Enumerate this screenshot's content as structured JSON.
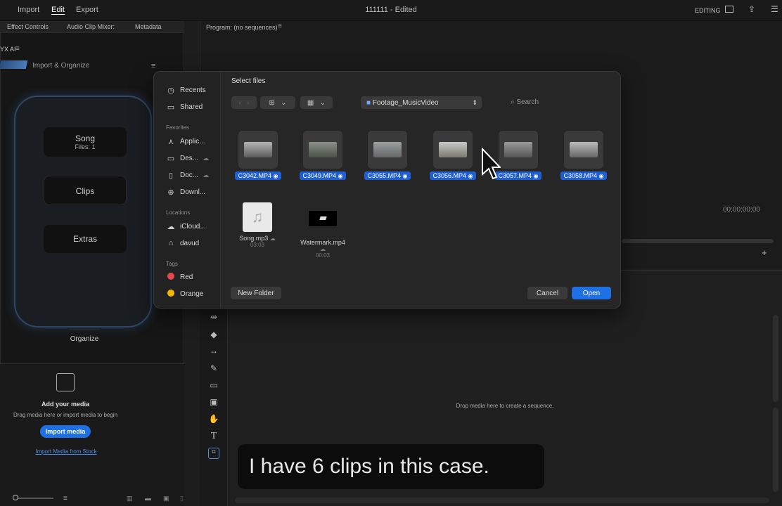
{
  "app": {
    "menu": [
      "Import",
      "Edit",
      "Export"
    ],
    "title": "111111 - Edited",
    "mode": "EDITING"
  },
  "panels": {
    "tabs": [
      "Effect Controls",
      "Audio Clip Mixer:",
      "Metadata"
    ],
    "program": "Program: (no sequences)",
    "plugin_tab": "YX AI",
    "plugin_header": "Import & Organize",
    "timecode": "00;00;00;00",
    "drop_hint": "Drop media here to create a sequence."
  },
  "phone": {
    "song_label": "Song",
    "song_files": "Files: 1",
    "clips_label": "Clips",
    "extras_label": "Extras",
    "organize_label": "Organize"
  },
  "import": {
    "title": "Add your media",
    "hint": "Drag media here or import media to begin",
    "button": "Import media",
    "stock_link": "Import Media from Stock"
  },
  "dialog": {
    "title": "Select files",
    "folder": "Footage_MusicVideo",
    "search_placeholder": "Search",
    "new_folder": "New Folder",
    "cancel": "Cancel",
    "open": "Open",
    "sidebar": {
      "recents": "Recents",
      "shared": "Shared",
      "favorites_header": "Favorites",
      "favorites": [
        "Applic...",
        "Des...",
        "Doc...",
        "Downl..."
      ],
      "locations_header": "Locations",
      "locations": [
        "iCloud...",
        "davud"
      ],
      "tags_header": "Tags",
      "tags": [
        "Red",
        "Orange"
      ]
    },
    "files": [
      {
        "name": "C3042.MP4"
      },
      {
        "name": "C3049.MP4"
      },
      {
        "name": "C3055.MP4"
      },
      {
        "name": "C3056.MP4"
      },
      {
        "name": "C3057.MP4"
      },
      {
        "name": "C3058.MP4"
      }
    ],
    "audio": {
      "name": "Song.mp3",
      "duration": "03:03"
    },
    "watermark": {
      "name": "Watermark.mp4",
      "duration": "00:03"
    }
  },
  "caption": "I have 6 clips in this case.",
  "colors": {
    "accent": "#1f6fe5",
    "tag_red": "#e5484d",
    "tag_orange": "#f5b800"
  }
}
